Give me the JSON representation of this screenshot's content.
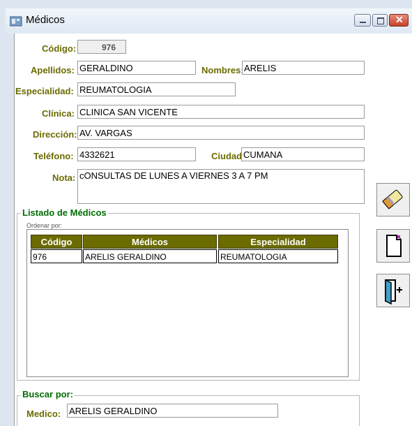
{
  "window": {
    "title": "Médicos"
  },
  "form": {
    "codigo_label": "Código:",
    "codigo_value": "976",
    "apellidos_label": "Apellidos:",
    "apellidos_value": "GERALDINO",
    "nombres_label": "Nombres:",
    "nombres_value": "ARELIS",
    "especialidad_label": "Especialidad:",
    "especialidad_value": "REUMATOLOGIA",
    "clinica_label": "Clínica:",
    "clinica_value": "CLINICA SAN VICENTE",
    "direccion_label": "Dirección:",
    "direccion_value": "AV. VARGAS",
    "telefono_label": "Teléfono:",
    "telefono_value": "4332621",
    "ciudad_label": "Ciudad:",
    "ciudad_value": "CUMANA",
    "nota_label": "Nota:",
    "nota_value": "cONSULTAS DE LUNES A VIERNES 3 A 7 PM"
  },
  "listado": {
    "title": "Listado de Médicos",
    "ordenar_label": "Ordenar por:",
    "columns": [
      "Código",
      "Médicos",
      "Especialidad"
    ],
    "rows": [
      [
        "976",
        "ARELIS GERALDINO",
        "REUMATOLOGIA"
      ]
    ]
  },
  "buscar": {
    "title": "Buscar por:",
    "medico_label": "Medico:",
    "medico_value": "ARELIS GERALDINO"
  },
  "colors": {
    "label": "#6b6b00",
    "group_title": "#006d00",
    "header_bg": "#6b6b00"
  },
  "icons": [
    "eraser-icon",
    "new-document-icon",
    "exit-door-icon"
  ]
}
